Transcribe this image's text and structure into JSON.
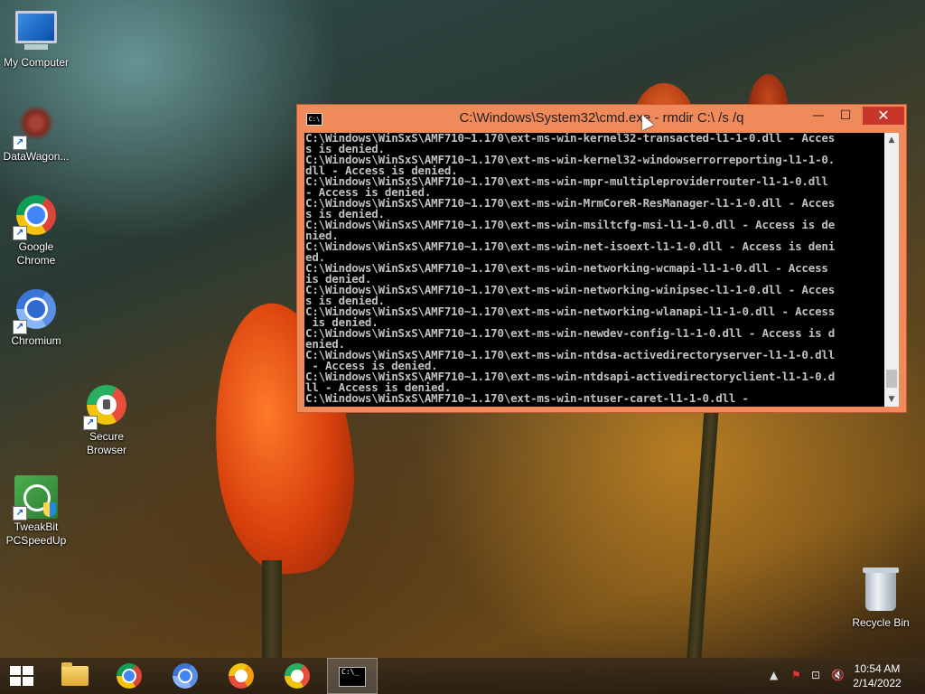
{
  "desktop": {
    "icons": [
      {
        "label": "My Computer"
      },
      {
        "label": "DataWagon..."
      },
      {
        "label": "Google Chrome"
      },
      {
        "label": "Chromium"
      },
      {
        "label": "Secure Browser"
      },
      {
        "label": "TweakBit PCSpeedUp"
      },
      {
        "label": "Recycle Bin"
      }
    ]
  },
  "cmd_window": {
    "title": "C:\\Windows\\System32\\cmd.exe - rmdir  C:\\ /s /q",
    "icon_text": "C:\\",
    "minimize": "—",
    "maximize": "☐",
    "close": "✕",
    "console_text": "C:\\Windows\\WinSxS\\AMF710~1.170\\ext-ms-win-kernel32-transacted-l1-1-0.dll - Acces\ns is denied.\nC:\\Windows\\WinSxS\\AMF710~1.170\\ext-ms-win-kernel32-windowserrorreporting-l1-1-0.\ndll - Access is denied.\nC:\\Windows\\WinSxS\\AMF710~1.170\\ext-ms-win-mpr-multipleproviderrouter-l1-1-0.dll\n- Access is denied.\nC:\\Windows\\WinSxS\\AMF710~1.170\\ext-ms-win-MrmCoreR-ResManager-l1-1-0.dll - Acces\ns is denied.\nC:\\Windows\\WinSxS\\AMF710~1.170\\ext-ms-win-msiltcfg-msi-l1-1-0.dll - Access is de\nnied.\nC:\\Windows\\WinSxS\\AMF710~1.170\\ext-ms-win-net-isoext-l1-1-0.dll - Access is deni\ned.\nC:\\Windows\\WinSxS\\AMF710~1.170\\ext-ms-win-networking-wcmapi-l1-1-0.dll - Access\nis denied.\nC:\\Windows\\WinSxS\\AMF710~1.170\\ext-ms-win-networking-winipsec-l1-1-0.dll - Acces\ns is denied.\nC:\\Windows\\WinSxS\\AMF710~1.170\\ext-ms-win-networking-wlanapi-l1-1-0.dll - Access\n is denied.\nC:\\Windows\\WinSxS\\AMF710~1.170\\ext-ms-win-newdev-config-l1-1-0.dll - Access is d\nenied.\nC:\\Windows\\WinSxS\\AMF710~1.170\\ext-ms-win-ntdsa-activedirectoryserver-l1-1-0.dll\n - Access is denied.\nC:\\Windows\\WinSxS\\AMF710~1.170\\ext-ms-win-ntdsapi-activedirectoryclient-l1-1-0.d\nll - Access is denied.\nC:\\Windows\\WinSxS\\AMF710~1.170\\ext-ms-win-ntuser-caret-l1-1-0.dll -",
    "scroll_up": "▲",
    "scroll_down": "▼"
  },
  "taskbar": {
    "cmd_icon_text": "C:\\_",
    "tray": {
      "up_arrow": "▲",
      "flag": "⚑",
      "network": "⊡",
      "volume": "🔇"
    },
    "clock": {
      "time": "10:54 AM",
      "date": "2/14/2022"
    }
  }
}
